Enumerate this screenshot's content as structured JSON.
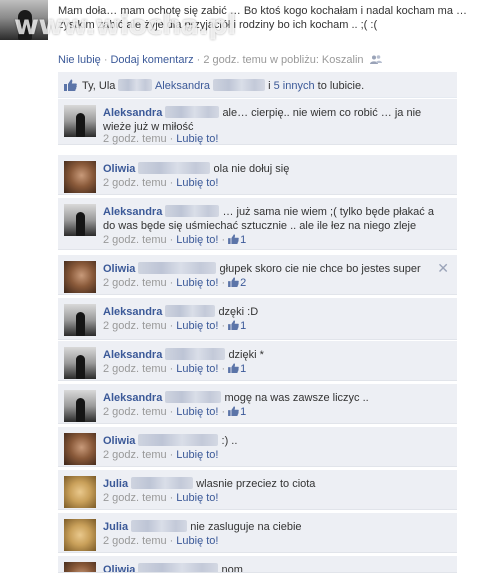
{
  "watermark": "www.wiocha.pl",
  "post": {
    "text": "Mam doła… mam ochotę się zabić … Bo ktoś kogo kochałam i nadal kocham ma … zystkim zabić ale żyje dla przyjaciół i rodziny bo ich kocham .. ;( :(",
    "actions": {
      "unlike": "Nie lubię",
      "comment": "Dodaj komentarz",
      "time": "2 godz. temu w pobliżu: Koszalin",
      "separator": "·"
    }
  },
  "likes": {
    "prefix": "Ty, Ula",
    "middle": "Aleksandra",
    "and": "i",
    "others": "5 innych",
    "suffix": "to lubicie."
  },
  "comment_meta": {
    "time": "2 godz. temu",
    "like": "Lubię to!",
    "separator": "·"
  },
  "comments": [
    {
      "name": "Aleksandra",
      "text": "ale… cierpię.. nie wiem co robić … ja nie wieże już w miłość",
      "likes": ""
    },
    {
      "name": "Oliwia",
      "text": "ola nie dołuj się",
      "likes": ""
    },
    {
      "name": "Aleksandra",
      "text": "… już sama nie wiem ;( tylko będe płakać a do was będe się uśmiechać sztucznie .. ale ile łez na niego zleje",
      "likes": "1"
    },
    {
      "name": "Oliwia",
      "text": "głupek skoro cie nie chce bo jestes super",
      "likes": "2"
    },
    {
      "name": "Aleksandra",
      "text": "dzęki :D",
      "likes": "1"
    },
    {
      "name": "Aleksandra",
      "text": "dzięki *",
      "likes": "1"
    },
    {
      "name": "Aleksandra",
      "text": "mogę na was zawsze liczyc ..",
      "likes": "1"
    },
    {
      "name": "Oliwia",
      "text": ":) ..",
      "likes": ""
    },
    {
      "name": "Julia",
      "text": "wlasnie przeciez to ciota",
      "likes": ""
    },
    {
      "name": "Julia",
      "text": "nie zasluguje na ciebie",
      "likes": ""
    },
    {
      "name": "Oliwia",
      "text": "nom",
      "likes": ""
    }
  ],
  "colors": {
    "link": "#3b5998",
    "comment_bg": "#edeff4",
    "meta": "#999999"
  }
}
